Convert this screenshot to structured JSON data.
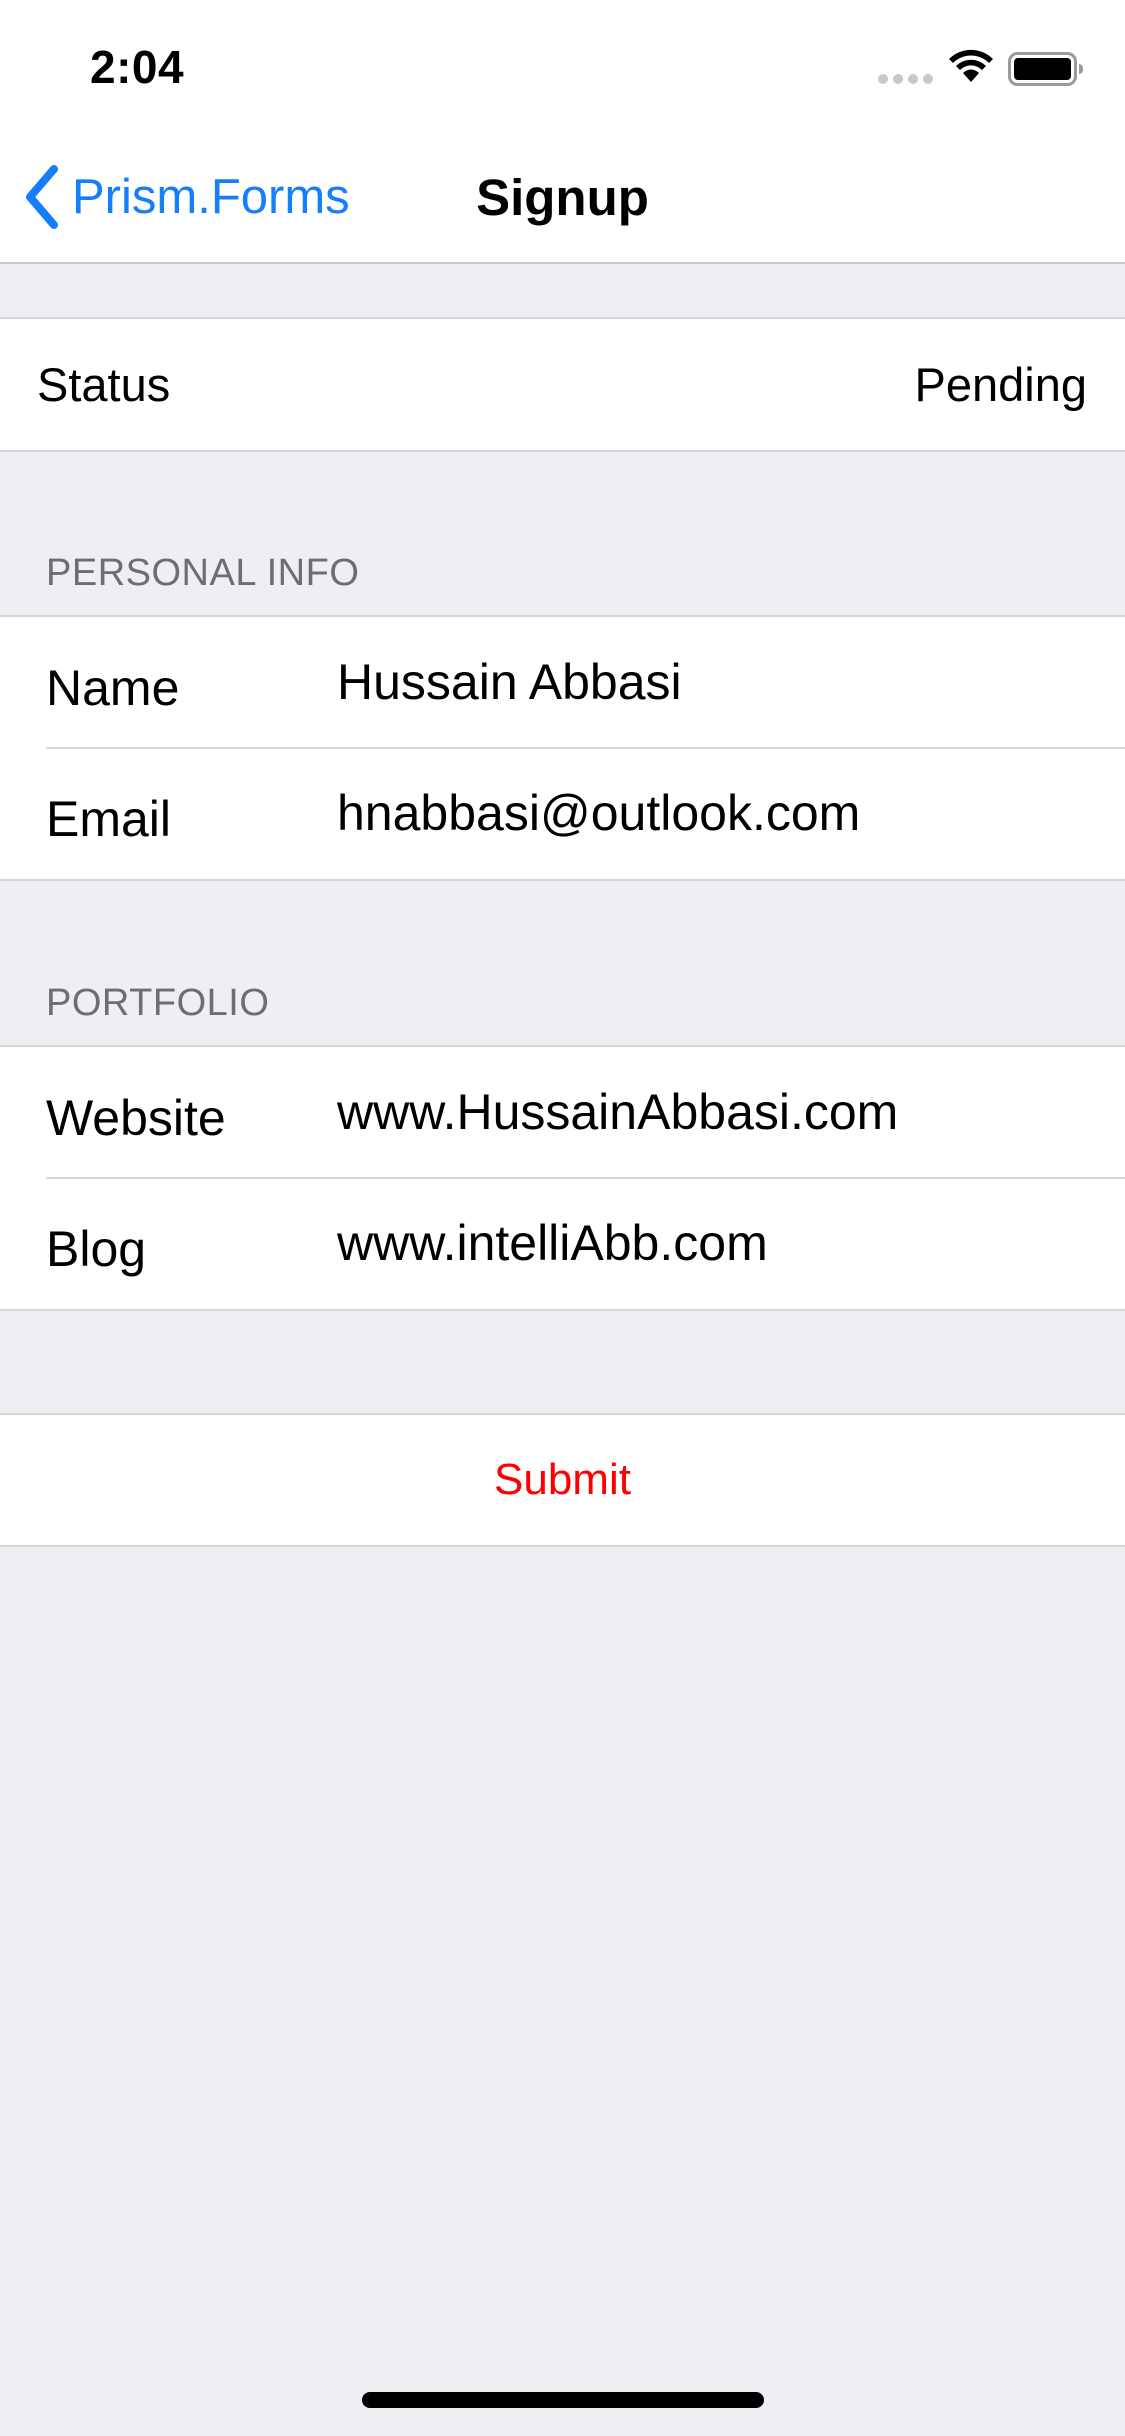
{
  "status_bar": {
    "time": "2:04"
  },
  "nav": {
    "back_label": "Prism.Forms",
    "title": "Signup"
  },
  "status_row": {
    "label": "Status",
    "value": "Pending"
  },
  "personal_info": {
    "header": "PERSONAL INFO",
    "fields": [
      {
        "label": "Name",
        "value": "Hussain Abbasi"
      },
      {
        "label": "Email",
        "value": "hnabbasi@outlook.com"
      }
    ]
  },
  "portfolio": {
    "header": "PORTFOLIO",
    "fields": [
      {
        "label": "Website",
        "value": "www.HussainAbbasi.com"
      },
      {
        "label": "Blog",
        "value": "www.intelliAbb.com"
      }
    ]
  },
  "submit_label": "Submit",
  "colors": {
    "accent": "#147EFB",
    "submit": "#FF0000",
    "background": "#EEEEF3",
    "section_header": "#6D6D72"
  },
  "icons": [
    "cellular-signal-icon",
    "wifi-icon",
    "battery-icon",
    "chevron-left-icon"
  ]
}
